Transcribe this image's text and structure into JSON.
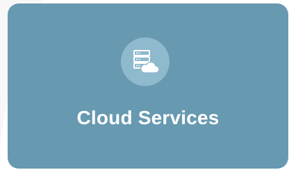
{
  "card": {
    "title": "Cloud Services",
    "icon": "server-cloud-icon"
  },
  "colors": {
    "page_background": "#ffffff",
    "background_shape": "#f7f7f8",
    "card_background": "#6799b1",
    "icon_circle": "#8fb9cd",
    "icon_foreground": "#ffffff",
    "text": "#ffffff"
  }
}
